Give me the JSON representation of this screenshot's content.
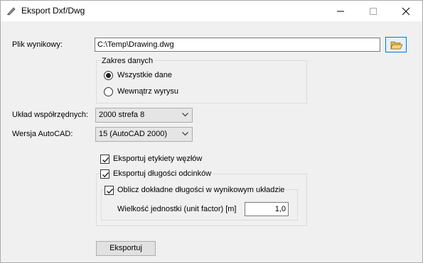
{
  "window": {
    "title": "Eksport Dxf/Dwg",
    "icons": {
      "app": "pen-icon",
      "minimize": "minimize-icon",
      "maximize": "maximize-icon",
      "close": "close-icon"
    }
  },
  "output_file": {
    "label": "Plik wynikowy:",
    "value": "C:\\Temp\\Drawing.dwg",
    "browse_icon": "open-folder-icon"
  },
  "data_range": {
    "legend": "Zakres danych",
    "options": [
      {
        "label": "Wszystkie dane",
        "selected": true
      },
      {
        "label": "Wewnątrz wyrysu",
        "selected": false
      }
    ]
  },
  "coordinate_system": {
    "label": "Układ współrzędnych:",
    "selected": "2000 strefa 8"
  },
  "autocad_version": {
    "label": "Wersja AutoCAD:",
    "selected": "15 (AutoCAD 2000)"
  },
  "options": {
    "export_node_labels": {
      "label": "Eksportuj etykiety węzłów",
      "checked": true
    },
    "export_segment_lengths": {
      "label": "Eksportuj długości odcinków",
      "checked": true
    },
    "exact_lengths": {
      "label": "Oblicz dokładne długości w wynikowym układzie",
      "checked": true
    },
    "unit_factor": {
      "label": "Wielkość jednostki (unit factor) [m]",
      "value": "1,0"
    }
  },
  "actions": {
    "export_label": "Eksportuj"
  }
}
